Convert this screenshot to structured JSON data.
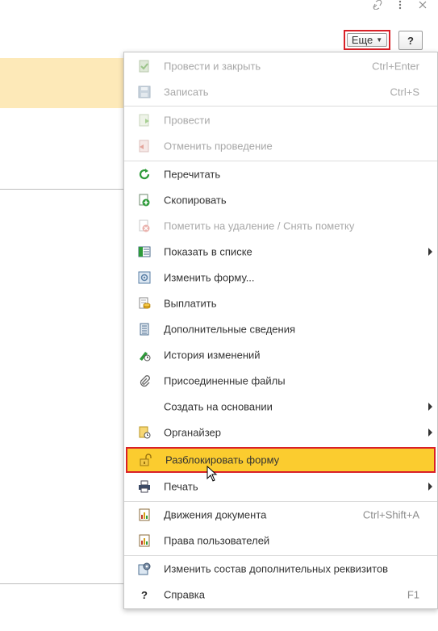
{
  "toolbar": {
    "more_label": "Еще",
    "help_label": "?"
  },
  "window_icons": [
    "link-icon",
    "kebab-menu-icon",
    "close-icon"
  ],
  "menu": {
    "items": [
      {
        "label": "Провести и закрыть",
        "shortcut": "Ctrl+Enter",
        "icon": "post-and-close-icon",
        "enabled": false
      },
      {
        "label": "Записать",
        "shortcut": "Ctrl+S",
        "icon": "save-icon",
        "enabled": false
      },
      {
        "label": "Провести",
        "shortcut": "",
        "icon": "post-icon",
        "enabled": false
      },
      {
        "label": "Отменить проведение",
        "shortcut": "",
        "icon": "unpost-icon",
        "enabled": false
      },
      {
        "label": "Перечитать",
        "shortcut": "",
        "icon": "refresh-icon",
        "enabled": true
      },
      {
        "label": "Скопировать",
        "shortcut": "",
        "icon": "copy-icon",
        "enabled": true
      },
      {
        "label": "Пометить на удаление / Снять пометку",
        "shortcut": "",
        "icon": "mark-delete-icon",
        "enabled": false
      },
      {
        "label": "Показать в списке",
        "shortcut": "",
        "icon": "show-in-list-icon",
        "enabled": true,
        "submenu": true
      },
      {
        "label": "Изменить форму...",
        "shortcut": "",
        "icon": "change-form-icon",
        "enabled": true
      },
      {
        "label": "Выплатить",
        "shortcut": "",
        "icon": "pay-icon",
        "enabled": true
      },
      {
        "label": "Дополнительные сведения",
        "shortcut": "",
        "icon": "additional-info-icon",
        "enabled": true
      },
      {
        "label": "История изменений",
        "shortcut": "",
        "icon": "history-icon",
        "enabled": true
      },
      {
        "label": "Присоединенные файлы",
        "shortcut": "",
        "icon": "paperclip-icon",
        "enabled": true
      },
      {
        "label": "Создать на основании",
        "shortcut": "",
        "icon": "",
        "enabled": true,
        "submenu": true
      },
      {
        "label": "Органайзер",
        "shortcut": "",
        "icon": "organizer-icon",
        "enabled": true,
        "submenu": true
      },
      {
        "label": "Разблокировать форму",
        "shortcut": "",
        "icon": "unlock-icon",
        "enabled": true,
        "highlighted": true
      },
      {
        "label": "Печать",
        "shortcut": "",
        "icon": "printer-icon",
        "enabled": true,
        "submenu": true
      },
      {
        "label": "Движения документа",
        "shortcut": "Ctrl+Shift+A",
        "icon": "document-movements-icon",
        "enabled": true
      },
      {
        "label": "Права пользователей",
        "shortcut": "",
        "icon": "user-rights-icon",
        "enabled": true
      },
      {
        "label": "Изменить состав дополнительных реквизитов",
        "shortcut": "",
        "icon": "gear-icon",
        "enabled": true
      },
      {
        "label": "Справка",
        "shortcut": "F1",
        "icon": "help-icon",
        "enabled": true
      }
    ]
  },
  "colors": {
    "highlight": "#fbcc2f",
    "focus_border": "#d92027",
    "disabled_text": "#a8a8a8",
    "background_accent": "#fde9b8"
  }
}
